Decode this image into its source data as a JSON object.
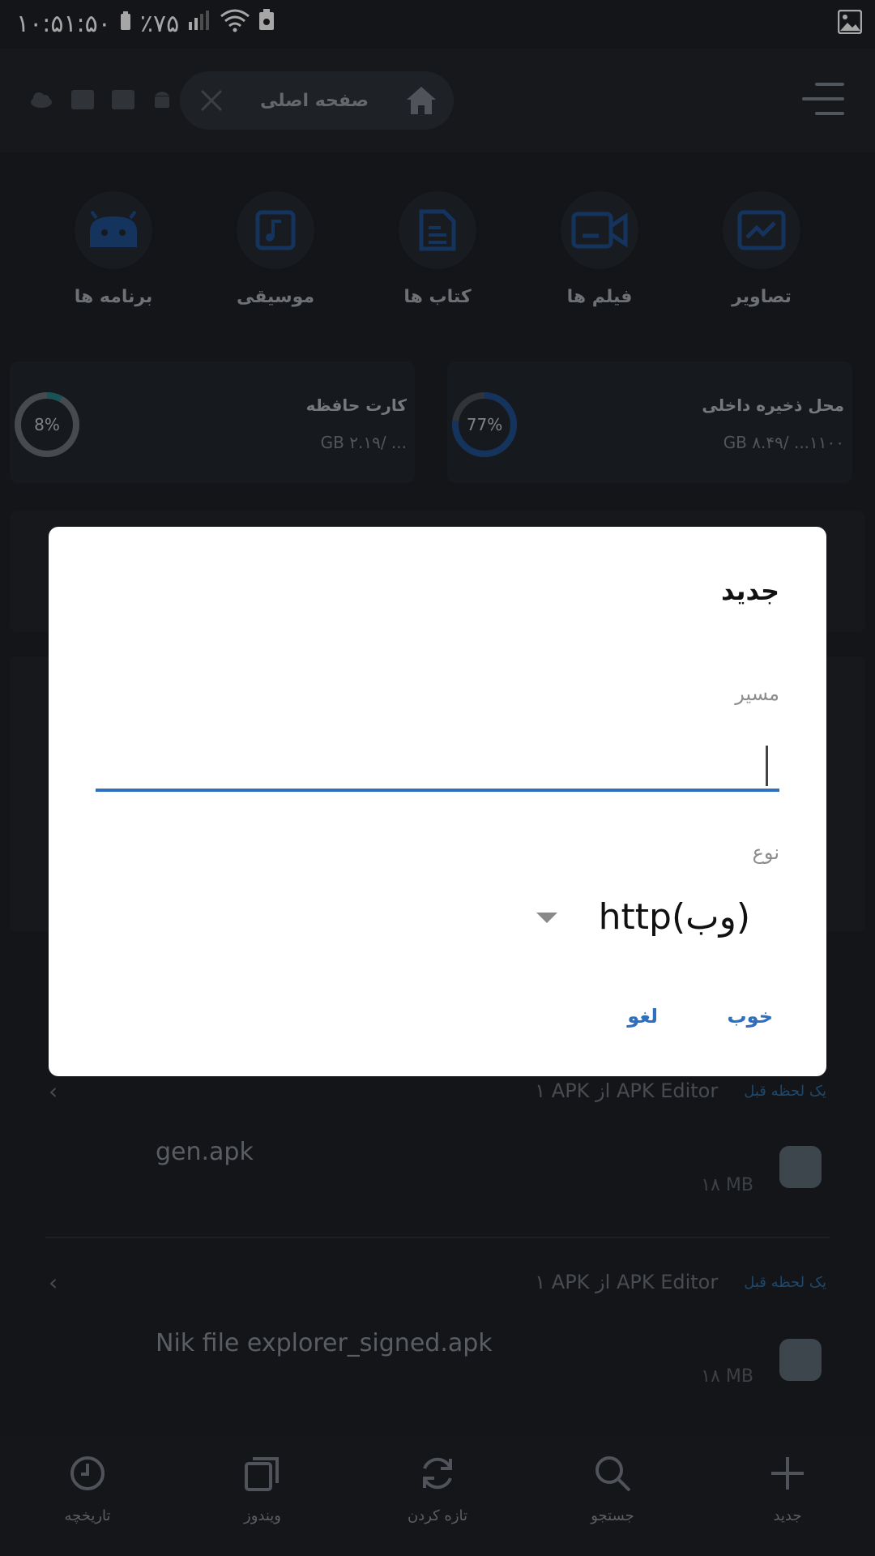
{
  "status_bar": {
    "time": "۱۰:۵۱:۵۰",
    "battery": "٪۷۵"
  },
  "top_bar": {
    "location_label": "صفحه اصلی"
  },
  "categories": [
    {
      "label": "تصاویر",
      "icon": "image-icon"
    },
    {
      "label": "فیلم ها",
      "icon": "video-icon"
    },
    {
      "label": "کتاب ها",
      "icon": "document-icon"
    },
    {
      "label": "موسیقی",
      "icon": "music-icon"
    },
    {
      "label": "برنامه ها",
      "icon": "android-icon"
    }
  ],
  "storage": {
    "internal": {
      "title": "محل ذخیره داخلی",
      "size": "۱۱۰۰... /۸.۴۹ GB",
      "percent_text": "77%",
      "percent": 77
    },
    "sd_card": {
      "title": "کارت حافظه",
      "size": "... /۲.۱۹ GB",
      "percent_text": "8%",
      "percent": 8
    }
  },
  "recent": [
    {
      "time": "یک لحظه قبل",
      "info": "۱ APK از APK Editor",
      "file": "gen.apk",
      "size": "۱۸ MB"
    },
    {
      "time": "یک لحظه قبل",
      "info": "۱ APK از APK Editor",
      "file": "Nik file explorer_signed.apk",
      "size": "۱۸ MB"
    }
  ],
  "bottom_nav": [
    {
      "label": "جدید",
      "icon": "plus-icon"
    },
    {
      "label": "جستجو",
      "icon": "search-icon"
    },
    {
      "label": "تازه کردن",
      "icon": "refresh-icon"
    },
    {
      "label": "ویندوز",
      "icon": "windows-icon"
    },
    {
      "label": "تاریخچه",
      "icon": "history-icon"
    }
  ],
  "dialog": {
    "title": "جدید",
    "path_label": "مسیر",
    "path_value": "",
    "type_label": "نوع",
    "type_value": "http(وب)",
    "ok_label": "خوب",
    "cancel_label": "لغو"
  },
  "colors": {
    "accent": "#2f6fc0",
    "background": "#1e2126",
    "dialog_bg": "#ffffff"
  }
}
